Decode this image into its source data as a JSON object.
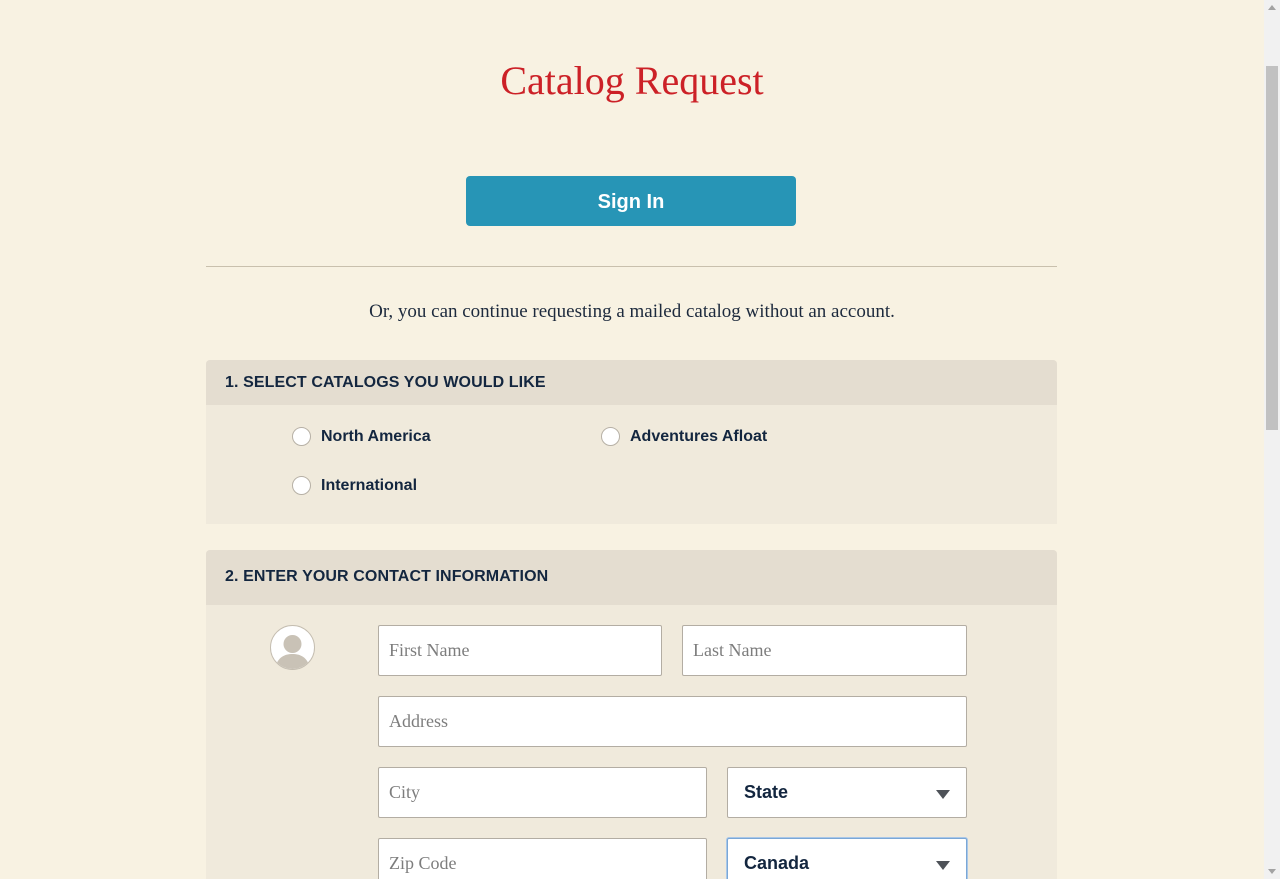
{
  "page": {
    "title": "Catalog Request",
    "signin_label": "Sign In",
    "or_text": "Or, you can continue requesting a mailed catalog without an account."
  },
  "section1": {
    "header": "1. SELECT CATALOGS YOU WOULD LIKE",
    "options": [
      {
        "label": "North America",
        "selected": false
      },
      {
        "label": "Adventures Afloat",
        "selected": false
      },
      {
        "label": "International",
        "selected": false
      }
    ]
  },
  "section2": {
    "header": "2. ENTER YOUR CONTACT INFORMATION",
    "avatar_icon": "person-icon",
    "fields": {
      "first_name": {
        "placeholder": "First Name",
        "value": ""
      },
      "last_name": {
        "placeholder": "Last Name",
        "value": ""
      },
      "address": {
        "placeholder": "Address",
        "value": ""
      },
      "city": {
        "placeholder": "City",
        "value": ""
      },
      "zip": {
        "placeholder": "Zip Code",
        "value": ""
      }
    },
    "state_select": {
      "value": "State"
    },
    "country_select": {
      "value": "Canada"
    }
  },
  "colors": {
    "background": "#f8f2e2",
    "title": "#cc2127",
    "button": "#2795b6",
    "section_header": "#e4ddd0",
    "section_body": "#f0eadc",
    "text": "#13263f"
  }
}
